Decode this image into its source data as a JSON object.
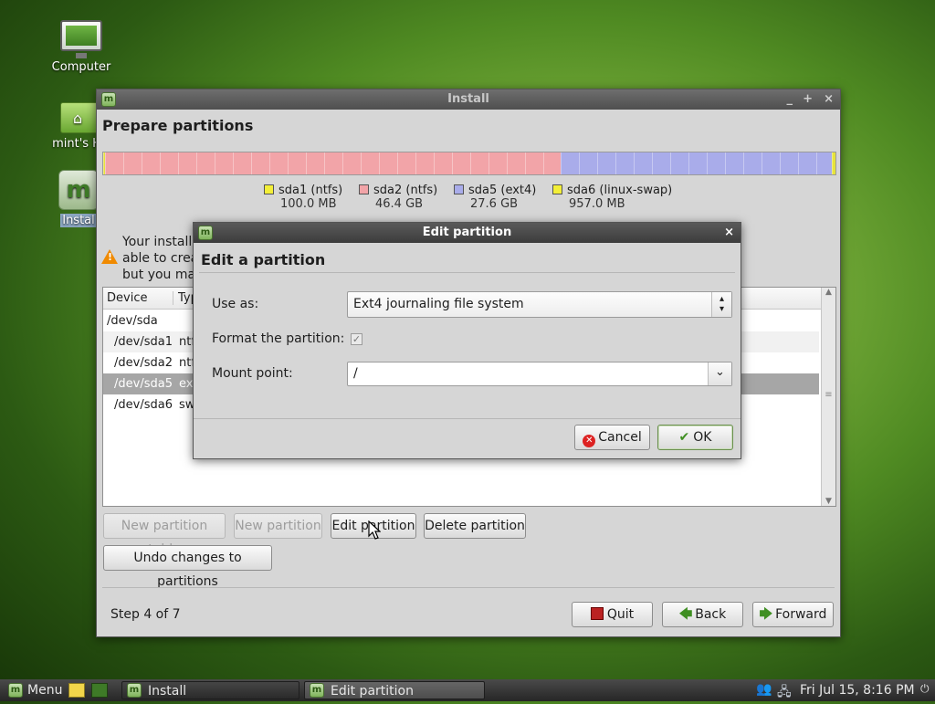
{
  "desktop": {
    "icons": [
      {
        "label": "Computer"
      },
      {
        "label": "mint's Ho"
      },
      {
        "label": "Instal"
      }
    ]
  },
  "install_window": {
    "title": "Install",
    "controls": {
      "minimize": "_",
      "maximize": "+",
      "close": "×"
    },
    "heading": "Prepare partitions",
    "disk_bar": {
      "segments": [
        {
          "name": "sda1",
          "fraction": 0.0007,
          "color": "#e7e43a"
        },
        {
          "name": "sda2",
          "fraction": 0.6216,
          "color": "#f2a4a8"
        },
        {
          "name": "sda5",
          "fraction": 0.37,
          "color": "#a9acea"
        },
        {
          "name": "sda6",
          "fraction": 0.0077,
          "color": "#e7e43a"
        }
      ]
    },
    "legend": [
      {
        "label": "sda1 (ntfs)",
        "size": "100.0 MB",
        "color": "#f3ef38"
      },
      {
        "label": "sda2 (ntfs)",
        "size": "46.4 GB",
        "color": "#f2a4a8"
      },
      {
        "label": "sda5 (ext4)",
        "size": "27.6 GB",
        "color": "#a9acea"
      },
      {
        "label": "sda6 (linux-swap)",
        "size": "957.0 MB",
        "color": "#f3ef38"
      }
    ],
    "warning_lines": [
      "Your installa",
      "able to crea",
      "but you may"
    ],
    "table": {
      "columns": [
        "Device",
        "Typ"
      ],
      "rows": [
        {
          "device": "/dev/sda",
          "type": ""
        },
        {
          "device": "/dev/sda1",
          "type": "ntf"
        },
        {
          "device": "/dev/sda2",
          "type": "ntf"
        },
        {
          "device": "/dev/sda5",
          "type": "ex"
        },
        {
          "device": "/dev/sda6",
          "type": "sw"
        }
      ]
    },
    "buttons": {
      "new_partition_table": "New partition table",
      "new_partition": "New partition",
      "edit_partition": "Edit partition",
      "delete_partition": "Delete partition",
      "undo_changes": "Undo changes to partitions"
    },
    "step": "Step 4 of 7",
    "nav": {
      "quit": "Quit",
      "back": "Back",
      "forward": "Forward"
    }
  },
  "dialog": {
    "title": "Edit partition",
    "close": "×",
    "heading": "Edit a partition",
    "use_as_label": "Use as:",
    "use_as_value": "Ext4 journaling file system",
    "format_label": "Format the partition:",
    "format_checked": true,
    "mount_label": "Mount point:",
    "mount_value": "/",
    "cancel": "Cancel",
    "ok": "OK"
  },
  "taskbar": {
    "menu": "Menu",
    "tasks": [
      "Install",
      "Edit partition"
    ],
    "clock": "Fri Jul 15,  8:16 PM"
  }
}
